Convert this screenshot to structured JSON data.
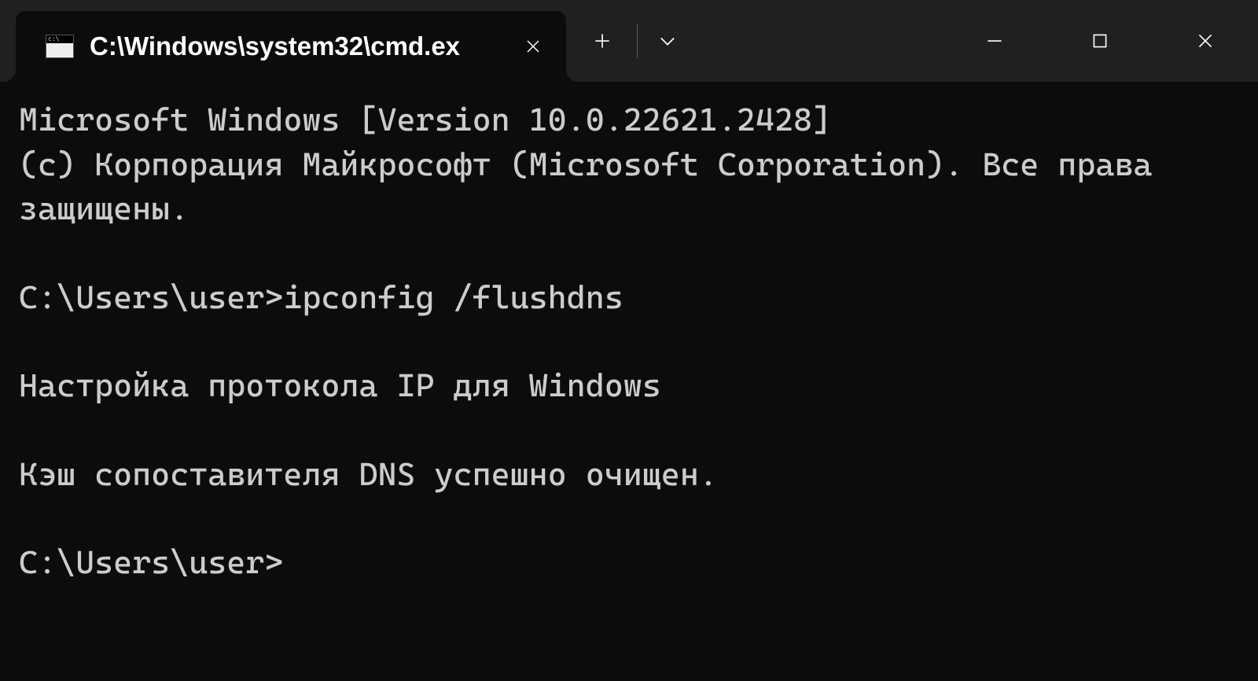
{
  "titlebar": {
    "tab": {
      "title": "C:\\Windows\\system32\\cmd.ex",
      "icon": "cmd-icon"
    }
  },
  "terminal": {
    "lines": [
      "Microsoft Windows [Version 10.0.22621.2428]",
      "(c) Корпорация Майкрософт (Microsoft Corporation). Все права защищены.",
      "",
      "C:\\Users\\user>ipconfig /flushdns",
      "",
      "Настройка протокола IP для Windows",
      "",
      "Кэш сопоставителя DNS успешно очищен.",
      "",
      "C:\\Users\\user>"
    ]
  }
}
